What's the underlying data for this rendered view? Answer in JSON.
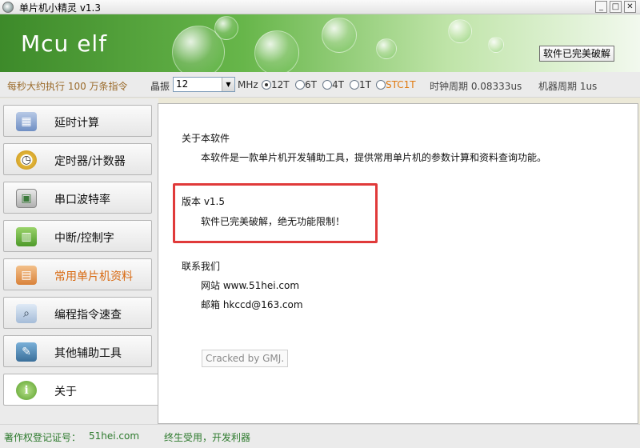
{
  "window": {
    "title": "单片机小精灵  v1.3",
    "buttons": {
      "minimize": "_",
      "maximize": "□",
      "close": "✕"
    }
  },
  "banner": {
    "logo": "Mcu elf",
    "crack_button": "软件已完美破解"
  },
  "toolbar": {
    "speed_text": "每秒大约执行 100 万条指令",
    "crystal_label": "晶振",
    "crystal_value": "12",
    "crystal_unit": "MHz",
    "modes": [
      {
        "label": "12T",
        "selected": true
      },
      {
        "label": "6T",
        "selected": false
      },
      {
        "label": "4T",
        "selected": false
      },
      {
        "label": "1T",
        "selected": false
      },
      {
        "label": "STC1T",
        "selected": false
      }
    ],
    "clock_period": "时钟周期 0.08333us",
    "machine_period": "机器周期 1us"
  },
  "sidebar": {
    "items": [
      {
        "label": "延时计算",
        "icon": "calculator-icon"
      },
      {
        "label": "定时器/计数器",
        "icon": "alarm-clock-icon"
      },
      {
        "label": "串口波特率",
        "icon": "monitor-icon"
      },
      {
        "label": "中断/控制字",
        "icon": "chip-icon"
      },
      {
        "label": "常用单片机资料",
        "icon": "book-icon"
      },
      {
        "label": "编程指令速查",
        "icon": "magnifier-icon"
      },
      {
        "label": "其他辅助工具",
        "icon": "toolbox-icon"
      },
      {
        "label": "关于",
        "icon": "info-icon"
      }
    ]
  },
  "content": {
    "about_title": "关于本软件",
    "about_desc": "本软件是一款单片机开发辅助工具，提供常用单片机的参数计算和资料查询功能。",
    "version": "版本  v1.5",
    "cracked_note": "软件已完美破解，绝无功能限制！",
    "contact_title": "联系我们",
    "website": "网站 www.51hei.com",
    "email": "邮箱 hkccd@163.com",
    "cracked_by": "Cracked by GMJ."
  },
  "status": {
    "copyright": "著作权登记证号：",
    "site": "51hei.com",
    "slogan": "终生受用，开发利器"
  },
  "colors": {
    "accent_green": "#67b64a",
    "highlight_red": "#e03a3a",
    "orange": "#d86a12"
  }
}
